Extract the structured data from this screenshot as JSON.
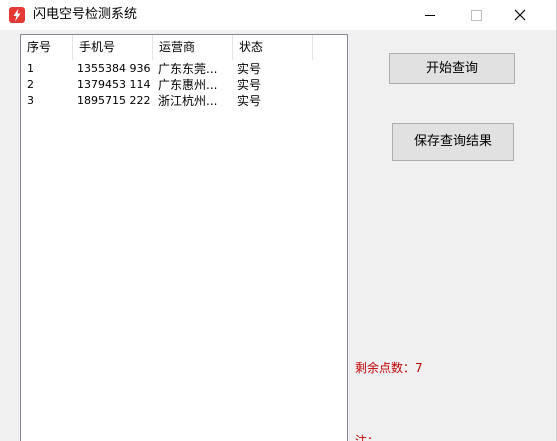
{
  "window": {
    "title": "闪电空号检测系统",
    "app_icon": "lightning-icon",
    "controls": {
      "minimize_icon": "minimize-icon",
      "maximize_icon": "maximize-icon",
      "close_icon": "close-icon"
    }
  },
  "table": {
    "columns": [
      "序号",
      "手机号",
      "运营商",
      "状态"
    ],
    "rows": [
      {
        "index": "1",
        "phone": "1355384  936",
        "carrier": "广东东莞...",
        "status": "实号"
      },
      {
        "index": "2",
        "phone": "1379453  114",
        "carrier": "广东惠州...",
        "status": "实号"
      },
      {
        "index": "3",
        "phone": "1895715  222",
        "carrier": "浙江杭州...",
        "status": "实号"
      }
    ]
  },
  "buttons": {
    "start": "开始查询",
    "save": "保存查询结果"
  },
  "status": {
    "points": "剩余点数：7",
    "note": "注："
  },
  "colors": {
    "accent_red": "#c00000",
    "icon_red": "#e53935"
  }
}
